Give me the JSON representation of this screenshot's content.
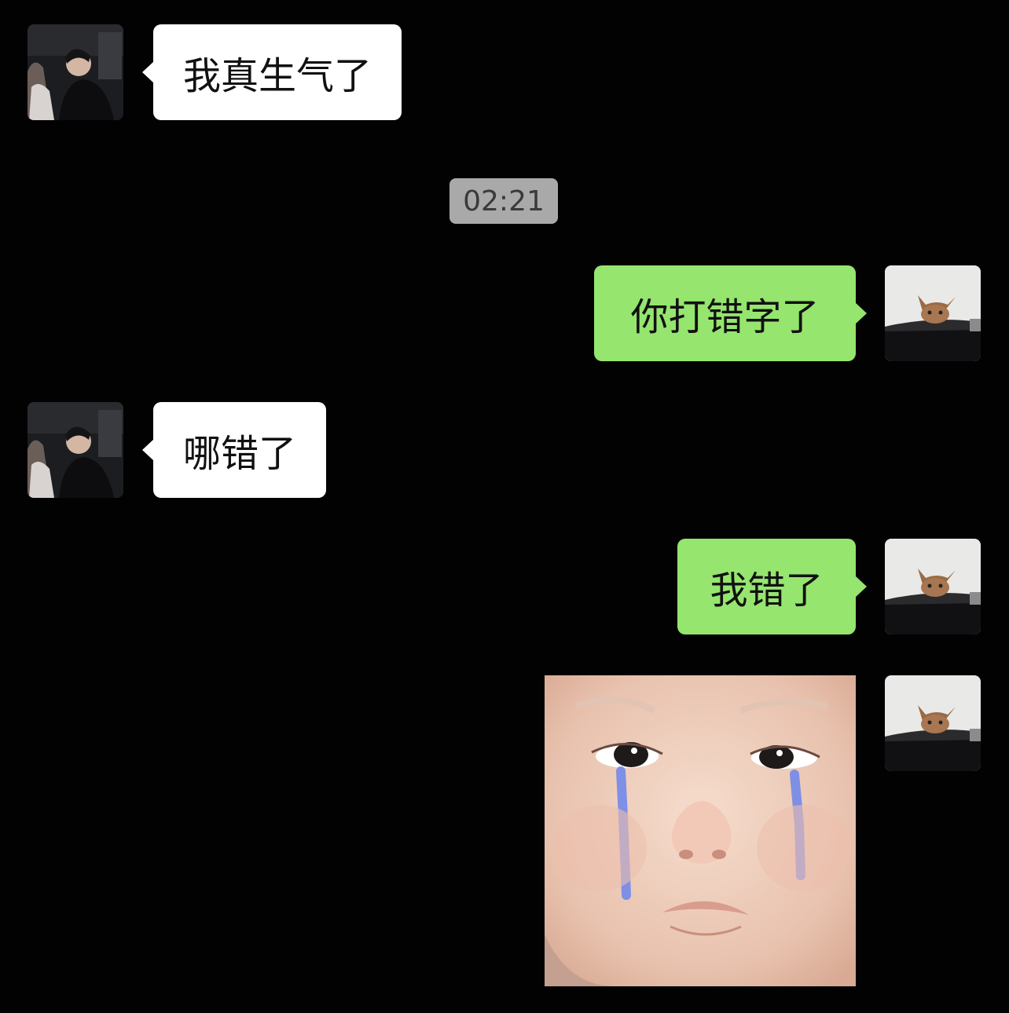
{
  "chat": {
    "timestamp": "02:21",
    "messages": [
      {
        "sender": "contact",
        "text": "我真生气了"
      },
      {
        "sender": "me",
        "text": "你打错字了"
      },
      {
        "sender": "contact",
        "text": "哪错了"
      },
      {
        "sender": "me",
        "text": "我错了"
      },
      {
        "sender": "me",
        "type": "sticker",
        "sticker": "crying-baby-sticker"
      }
    ]
  },
  "colors": {
    "background": "#020203",
    "incoming_bubble": "#ffffff",
    "outgoing_bubble": "#95e56e",
    "timestamp_bg": "#a9a9a9",
    "tear": "#7f8fe6"
  },
  "icons": {
    "contact_avatar": "couple-photo-avatar",
    "my_avatar": "cat-peeking-avatar"
  }
}
